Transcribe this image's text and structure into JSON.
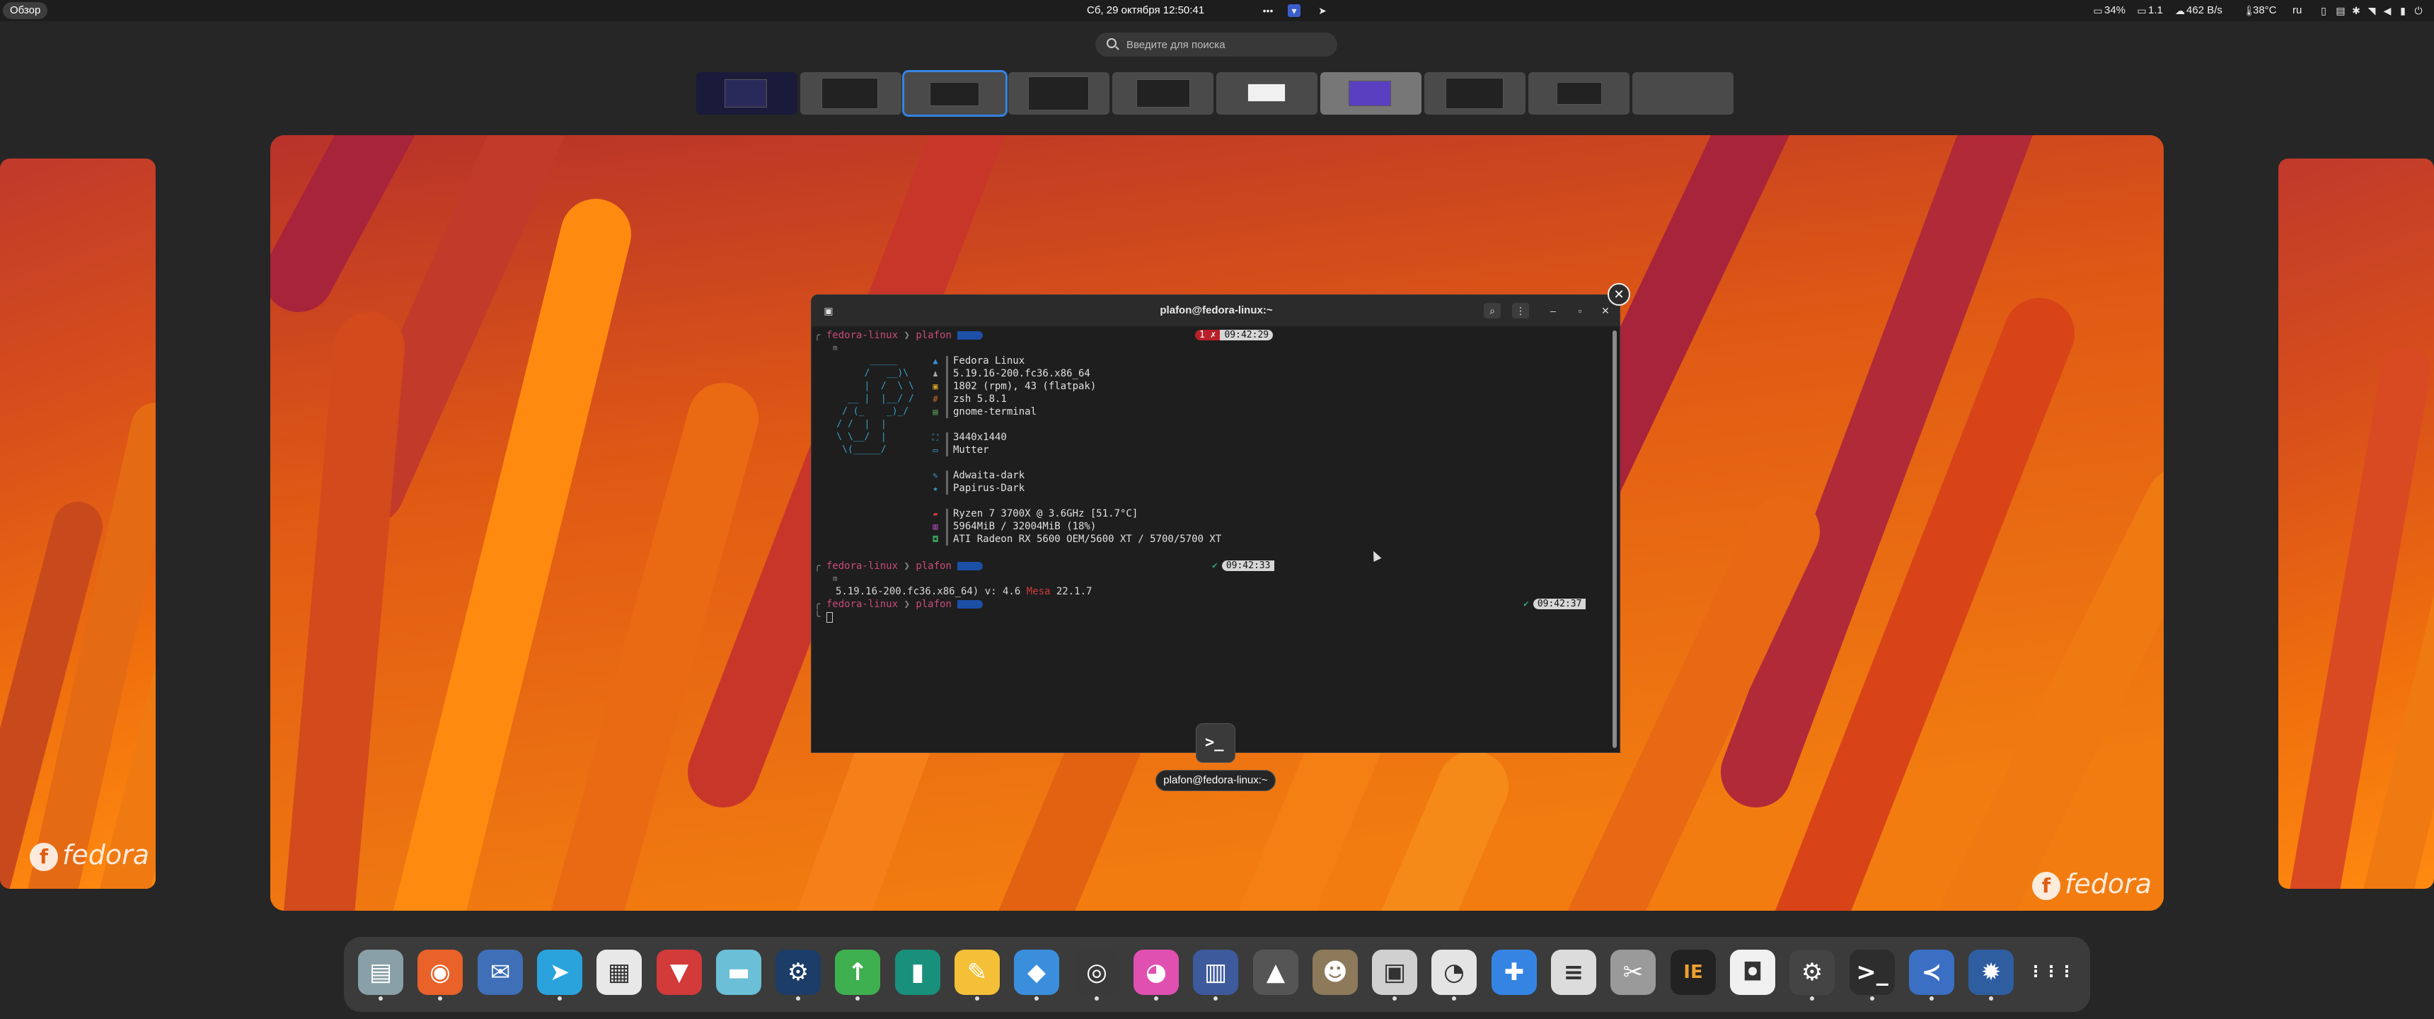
{
  "topbar": {
    "activities_label": "Обзор",
    "clock": "Сб, 29 октября  12:50:41",
    "battery": "34%",
    "load": "1.1",
    "net": "462 B/s",
    "temp": "38°C",
    "lang": "ru"
  },
  "search": {
    "placeholder": "Введите для поиска"
  },
  "workspace_count": 10,
  "terminal": {
    "title": "plafon@fedora-linux:~",
    "prompt_host": "fedora-linux",
    "prompt_sep": "❯",
    "prompt_user": "plafon",
    "cmd_glyph": "m",
    "badge1_err": "1 ✗",
    "badge1_time": "09:42:29",
    "badge2_ok": "✔",
    "badge2_time": "09:42:33",
    "badge3_ok": "✔",
    "badge3_time": "09:42:37",
    "fetch": [
      {
        "value": "Fedora Linux"
      },
      {
        "value": "5.19.16-200.fc36.x86_64"
      },
      {
        "value": "1802 (rpm), 43 (flatpak)"
      },
      {
        "value": "zsh 5.8.1"
      },
      {
        "value": "gnome-terminal"
      },
      {
        "value": "3440x1440"
      },
      {
        "value": "Mutter"
      },
      {
        "value": "Adwaita-dark"
      },
      {
        "value": "Papirus-Dark"
      },
      {
        "value": "Ryzen 7 3700X @ 3.6GHz [51.7°C]"
      },
      {
        "value": "5964MiB / 32004MiB (18%)"
      },
      {
        "value": "ATI Radeon RX 5600 OEM/5600 XT / 5700/5700 XT"
      }
    ],
    "output_kernel": "5.19.16-200.fc36.x86_64) v: 4.6 ",
    "output_mesa": "Mesa",
    "output_ver": " 22.1.7"
  },
  "window_label": "plafon@fedora-linux:~",
  "wallpaper_logo": "fedora",
  "dock_apps": [
    {
      "name": "files",
      "glyph": "▤",
      "bg": "#8aa0a8"
    },
    {
      "name": "firefox",
      "glyph": "◉",
      "bg": "#e8622a"
    },
    {
      "name": "thunderbird",
      "glyph": "✉",
      "bg": "#3f6fb6"
    },
    {
      "name": "telegram",
      "glyph": "➤",
      "bg": "#2aa3dd"
    },
    {
      "name": "calendar",
      "glyph": "▦",
      "bg": "#e8e8e8"
    },
    {
      "name": "inbox",
      "glyph": "▼",
      "bg": "#d33a3a"
    },
    {
      "name": "scanner",
      "glyph": "▬",
      "bg": "#6bbfd6"
    },
    {
      "name": "steam",
      "glyph": "⚙",
      "bg": "#1b3d67"
    },
    {
      "name": "updater",
      "glyph": "↑",
      "bg": "#3fb04f"
    },
    {
      "name": "notebook",
      "glyph": "▮",
      "bg": "#18907c"
    },
    {
      "name": "text-editor",
      "glyph": "✎",
      "bg": "#f4c037"
    },
    {
      "name": "layers",
      "glyph": "◆",
      "bg": "#3a8edc"
    },
    {
      "name": "obs",
      "glyph": "◎",
      "bg": "#3a3a3a"
    },
    {
      "name": "color-picker",
      "glyph": "◕",
      "bg": "#e050b0"
    },
    {
      "name": "ebook",
      "glyph": "▥",
      "bg": "#3d5a9c"
    },
    {
      "name": "inkscape",
      "glyph": "▲",
      "bg": "#555555"
    },
    {
      "name": "gimp",
      "glyph": "☻",
      "bg": "#8c7a5a"
    },
    {
      "name": "screenshot",
      "glyph": "▣",
      "bg": "#d0d0d0"
    },
    {
      "name": "disk-usage",
      "glyph": "◔",
      "bg": "#e4e4e4"
    },
    {
      "name": "extensions",
      "glyph": "✚",
      "bg": "#3584e4"
    },
    {
      "name": "tweaks",
      "glyph": "≡",
      "bg": "#dcdcdc"
    },
    {
      "name": "tools",
      "glyph": "✂",
      "bg": "#9a9a9a"
    },
    {
      "name": "ide",
      "glyph": "IE",
      "bg": "#222222"
    },
    {
      "name": "software",
      "glyph": "◘",
      "bg": "#f0f0f0"
    },
    {
      "name": "settings",
      "glyph": "⚙",
      "bg": "#444444"
    },
    {
      "name": "terminal",
      "glyph": ">_",
      "bg": "#2d2d2d"
    },
    {
      "name": "vscode",
      "glyph": "≺",
      "bg": "#3a6fc4"
    },
    {
      "name": "system-settings",
      "glyph": "✹",
      "bg": "#2e5ea0"
    },
    {
      "name": "app-grid",
      "glyph": "⋮⋮⋮",
      "bg": "#3b3b3b"
    }
  ]
}
